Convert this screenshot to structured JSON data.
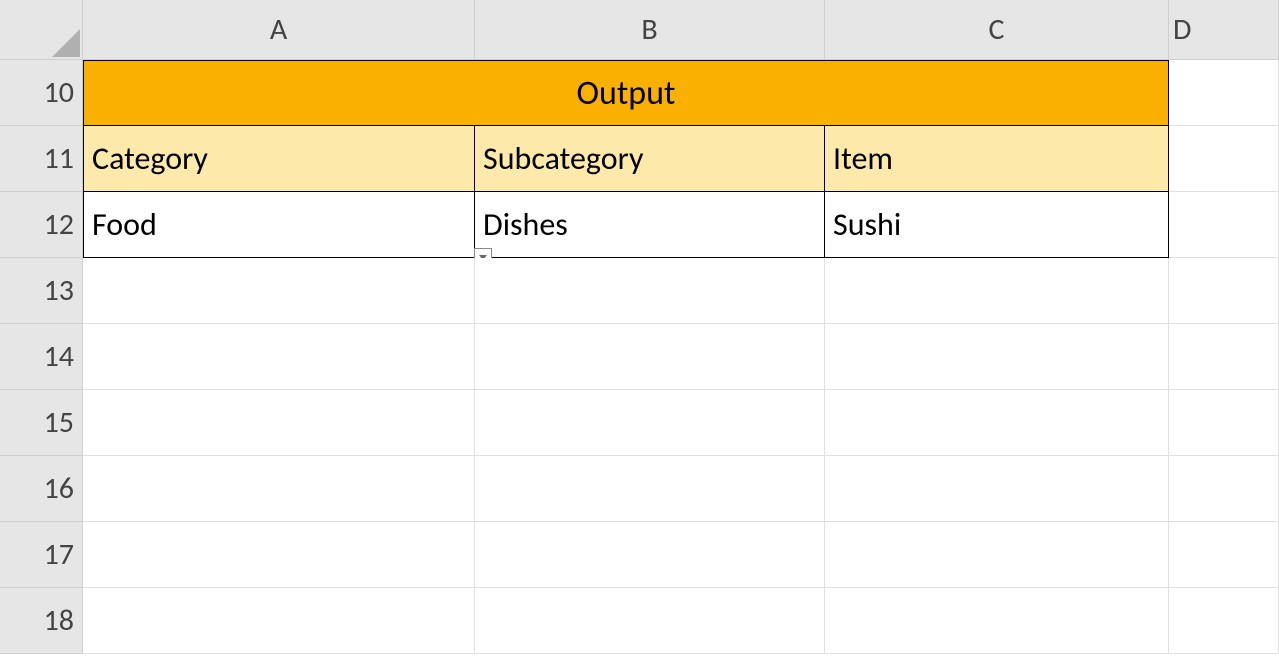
{
  "columns": [
    "A",
    "B",
    "C",
    "D"
  ],
  "rows": [
    "10",
    "11",
    "12",
    "13",
    "14",
    "15",
    "16",
    "17",
    "18"
  ],
  "title": "Output",
  "headers": {
    "category": "Category",
    "subcategory": "Subcategory",
    "item": "Item"
  },
  "data": {
    "category": "Food",
    "subcategory": "Dishes",
    "item": " Sushi"
  },
  "colors": {
    "titleBg": "#f9b000",
    "headerBg": "#fde9a9"
  }
}
